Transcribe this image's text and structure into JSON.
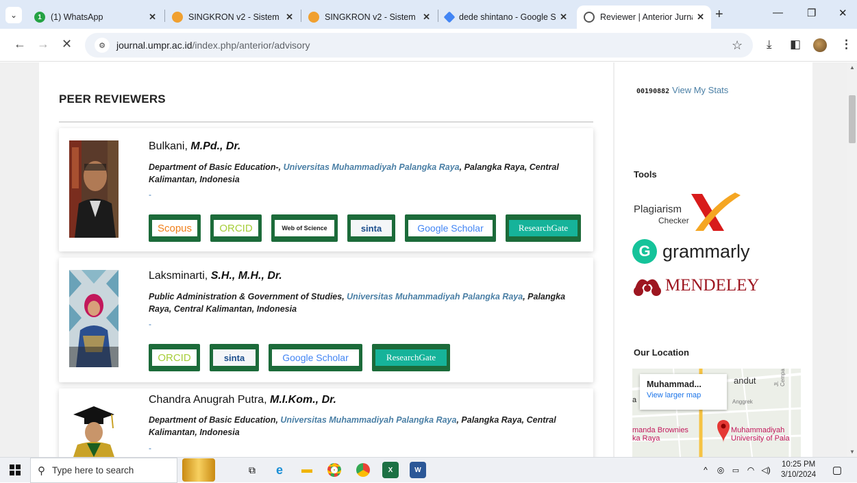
{
  "browser": {
    "tabs": [
      {
        "title": "(1) WhatsApp",
        "icon": "whatsapp-icon",
        "badge": "1"
      },
      {
        "title": "SINGKRON v2 - Sistem In",
        "icon": "singkron-icon"
      },
      {
        "title": "SINGKRON v2 - Sistem In",
        "icon": "singkron-icon"
      },
      {
        "title": "dede shintano - Google S",
        "icon": "google-scholar-icon"
      },
      {
        "title": "Reviewer | Anterior Jurna",
        "icon": "journal-icon",
        "active": true
      }
    ],
    "url_domain": "journal.umpr.ac.id",
    "url_path": "/index.php/anterior/advisory"
  },
  "page": {
    "title": "PEER REVIEWERS",
    "reviewers": [
      {
        "name": "Bulkani, ",
        "degree": "M.Pd., Dr.",
        "dept": "Department of Basic Education-, ",
        "university": "Universitas Muhammadiyah Palangka Raya",
        "location": ", Palangka Raya, Central Kalimantan, Indonesia",
        "dash": "-",
        "badges": [
          "Scopus",
          "ORCID",
          "Web of Science",
          "sinta",
          "Google Scholar",
          "ResearchGate"
        ]
      },
      {
        "name": "Laksminarti, ",
        "degree": "S.H., M.H., Dr.",
        "dept": "Public Administration & Government of Studies, ",
        "university": "Universitas Muhammadiyah Palangka Raya",
        "location": ", Palangka Raya, Central Kalimantan, Indonesia",
        "dash": "-",
        "badges": [
          "ORCID",
          "sinta",
          "Google Scholar",
          "ResearchGate"
        ]
      },
      {
        "name": "Chandra Anugrah Putra, ",
        "degree": "M.I.Kom., Dr.",
        "dept": "Department of Basic Education, ",
        "university": "Universitas Muhammadiyah Palangka Raya",
        "location": ", Palangka Raya, Central Kalimantan, Indonesia",
        "dash": "-"
      }
    ]
  },
  "sidebar": {
    "stats_number": "00190882",
    "stats_link": "View My Stats",
    "tools_heading": "Tools",
    "plagiarism_line1": "Plagiarism",
    "plagiarism_line2": "Checker",
    "grammarly": "grammarly",
    "mendeley": "MENDELEY",
    "location_heading": "Our Location",
    "map": {
      "popup_title": "Muhammad...",
      "popup_link": "View larger map",
      "label_andut": "andut",
      "label_anggrek": "Anggrek",
      "label_cempaka": "Jl. Cempaka",
      "label_brownies": "manda Brownies",
      "label_raya": "ka Raya",
      "label_univ1": "Muhammadiyah",
      "label_univ2": "University of Pala",
      "label_b": "a"
    }
  },
  "taskbar": {
    "search_placeholder": "Type here to search",
    "time": "10:25 PM",
    "date": "3/10/2024"
  }
}
